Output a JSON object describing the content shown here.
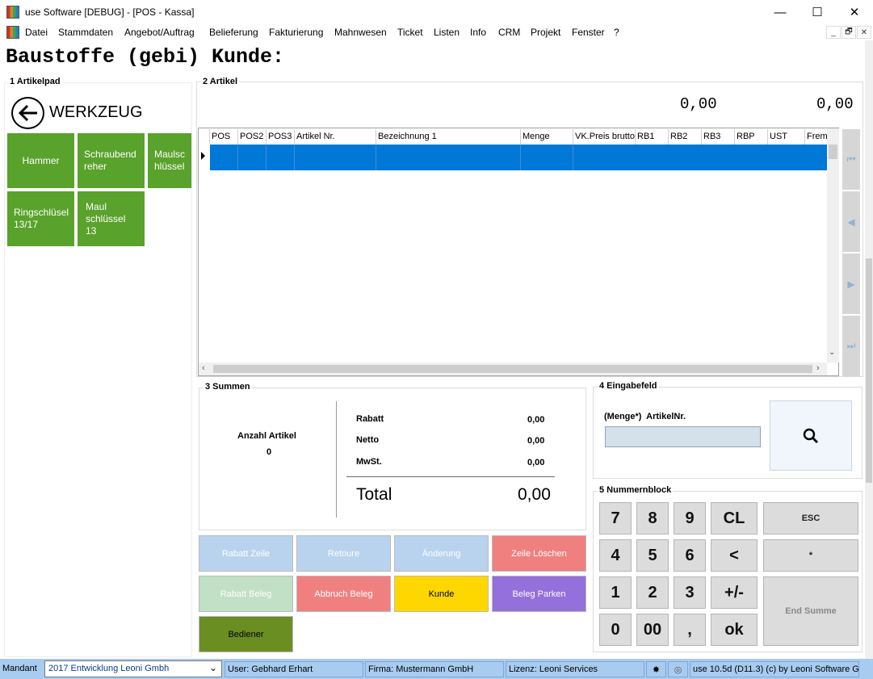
{
  "window": {
    "title": "use Software [DEBUG] - [POS - Kassa]",
    "minimize": "—",
    "maximize": "☐",
    "close": "✕"
  },
  "menu": [
    "Datei",
    "Stammdaten",
    "Angebot/Auftrag",
    "Belieferung",
    "Fakturierung",
    "Mahnwesen",
    "Ticket",
    "Listen",
    "Info",
    "CRM",
    "Projekt",
    "Fenster",
    "?"
  ],
  "mdi_buttons": [
    "_",
    "🗗",
    "✕"
  ],
  "heading": "Baustoffe (gebi) Kunde:",
  "artikelpad": {
    "title": "1 Artikelpad",
    "back_label": "WERKZEUG",
    "tiles": [
      "Hammer",
      "Schraubendreher",
      "Maulschlüssel",
      "Ringschlüsel 13/17",
      "Maul schlüssel 13"
    ]
  },
  "artikel": {
    "title": "2 Artikel",
    "total_left": "0,00",
    "total_right": "0,00",
    "columns": [
      "POS",
      "POS2",
      "POS3",
      "Artikel Nr.",
      "Bezeichnung 1",
      "Menge",
      "VK.Preis brutto",
      "RB1",
      "RB2",
      "RB3",
      "RBP",
      "UST",
      "Frem"
    ],
    "nav": [
      "⏮",
      "◀",
      "▶",
      "⏭"
    ]
  },
  "summen": {
    "title": "3 Summen",
    "anzahl_label": "Anzahl Artikel",
    "anzahl_value": "0",
    "rabatt_label": "Rabatt",
    "rabatt_value": "0,00",
    "netto_label": "Netto",
    "netto_value": "0,00",
    "mwst_label": "MwSt.",
    "mwst_value": "0,00",
    "total_label": "Total",
    "total_value": "0,00"
  },
  "eingabefeld": {
    "title": "4 Eingabefeld",
    "label": "(Menge*)  ArtikelNr.",
    "value": ""
  },
  "actions": {
    "rabatt_zeile": "Rabatt Zeile",
    "retoure": "Retoure",
    "aenderung": "Änderung",
    "zeile_loeschen": "Zeile Löschen",
    "rabatt_beleg": "Rabatt Beleg",
    "abbruch_beleg": "Abbruch Beleg",
    "kunde": "Kunde",
    "beleg_parken": "Beleg Parken",
    "bediener": "Bediener"
  },
  "nummernblock": {
    "title": "5 Nummernblock",
    "keys": [
      "7",
      "8",
      "9",
      "CL",
      "4",
      "5",
      "6",
      "<",
      "1",
      "2",
      "3",
      "+/-",
      "0",
      "00",
      ",",
      "ok"
    ],
    "esc": "ESC",
    "star": "*",
    "end_summe": "End Summe"
  },
  "status": {
    "mandant_label": "Mandant",
    "mandant_value": "2017  Entwicklung Leoni Gmbh",
    "user": "User: Gebhard Erhart",
    "firma": "Firma: Mustermann GmbH",
    "lizenz": "Lizenz: Leoni Services",
    "version": "use 10.5d (D11.3) (c) by Leoni Software G"
  },
  "colors": {
    "tile_green": "#59a22b",
    "selection_blue": "#0078d7",
    "status_blue": "#a8cbf0"
  }
}
